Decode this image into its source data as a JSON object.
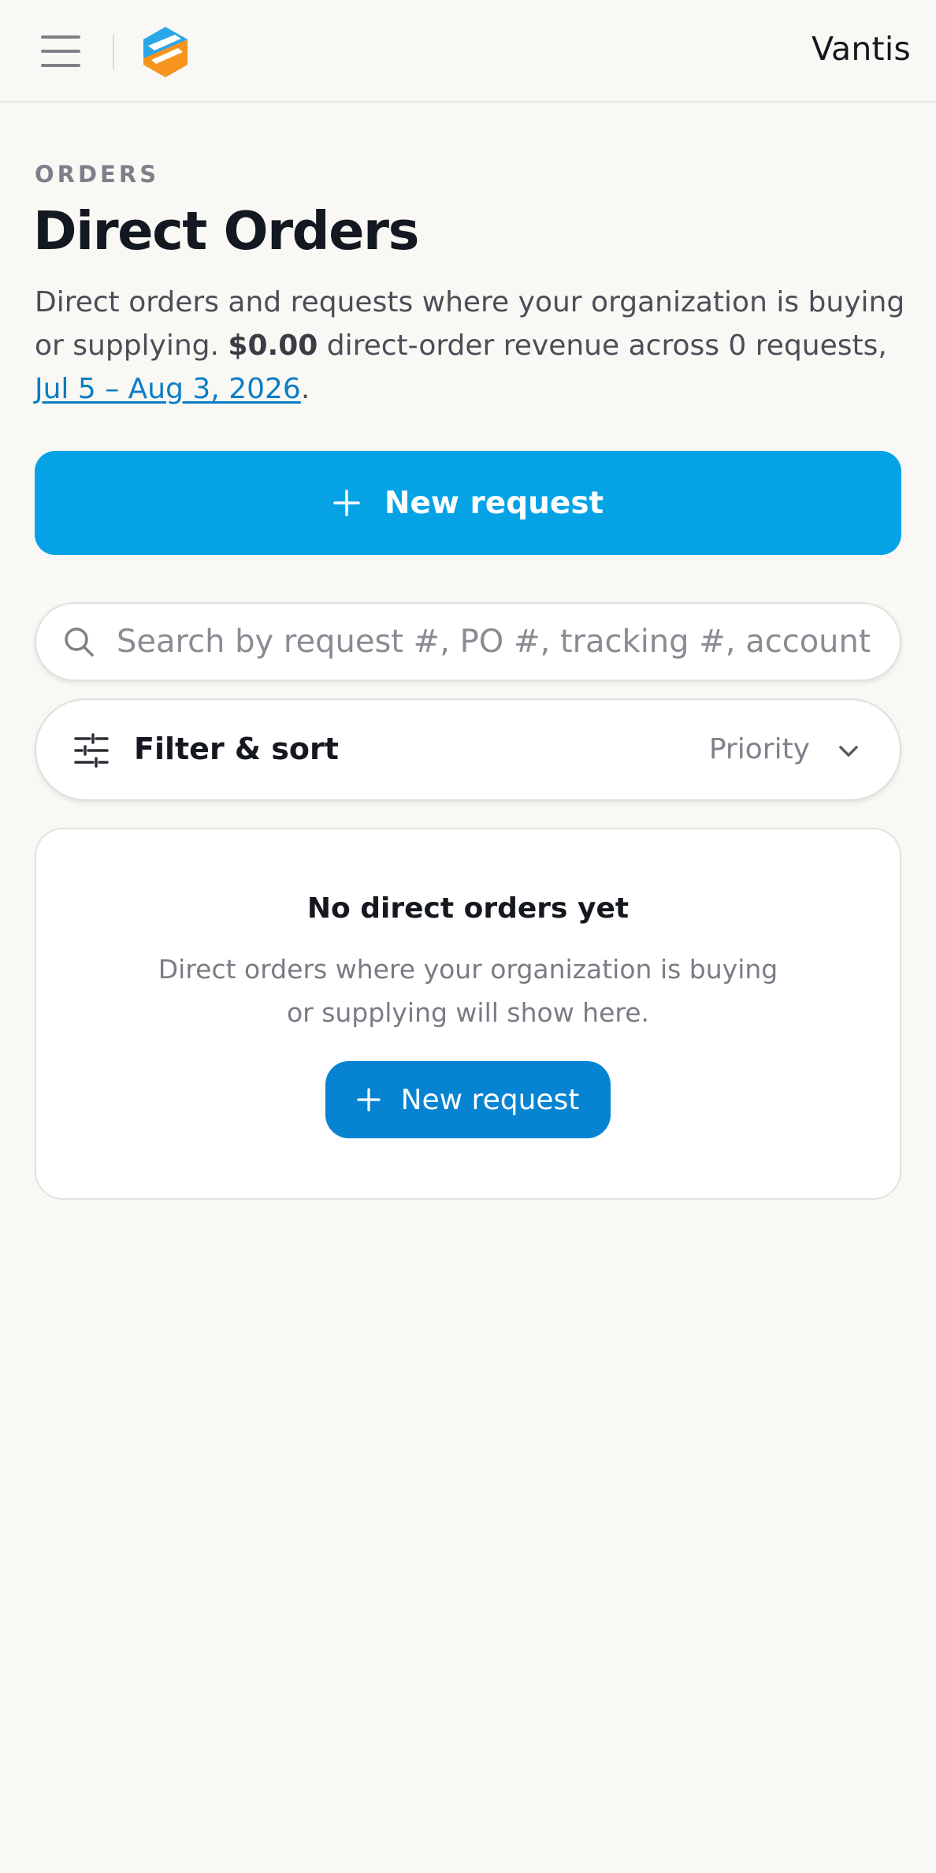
{
  "header": {
    "org_name": "Vantis",
    "logo_colors": [
      "#2aa7e9",
      "#f7941d"
    ]
  },
  "page": {
    "eyebrow": "ORDERS",
    "title": "Direct Orders",
    "description_prefix": "Direct orders and requests where your organization is buying or supplying. ",
    "revenue": "$0.00",
    "description_middle": " direct-order revenue across 0 requests, ",
    "date_range": "Jul 5 – Aug 3, 2026",
    "description_suffix": "."
  },
  "primary_action": {
    "label": "New request",
    "color": "#05a3e6"
  },
  "search": {
    "placeholder": "Search by request #, PO #, tracking #, account, representative",
    "value": ""
  },
  "filter": {
    "label": "Filter & sort",
    "sort_value": "Priority"
  },
  "empty_state": {
    "title": "No direct orders yet",
    "description": "Direct orders where your organization is buying or supplying will show here.",
    "button_label": "New request",
    "button_color": "#0684d1"
  }
}
